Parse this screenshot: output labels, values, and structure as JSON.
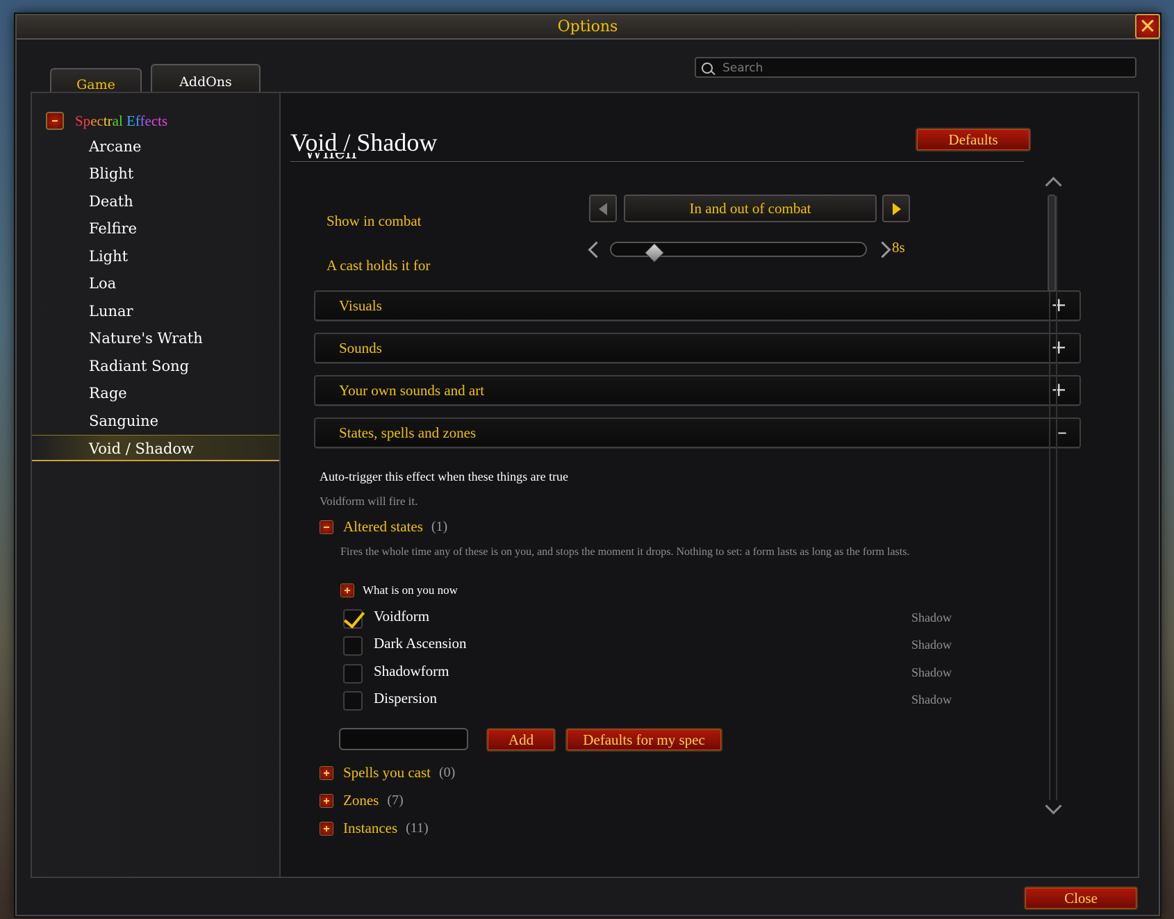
{
  "window": {
    "title": "Options",
    "close_icon": "close-x-icon"
  },
  "tabs": [
    {
      "label": "Game"
    },
    {
      "label": "AddOns"
    }
  ],
  "search": {
    "placeholder": "Search",
    "value": ""
  },
  "sidebar": {
    "category": {
      "label_parts": [
        "Sp",
        "ec",
        "tr",
        "al",
        " ",
        "Ef",
        "fe",
        "cts"
      ],
      "colors": [
        "#ff3b3b",
        "#ff8a2a",
        "#ffd11a",
        "#5ad13a",
        "#ffffff",
        "#35a8ff",
        "#9b5cff",
        "#e04ad8"
      ]
    },
    "items": [
      {
        "label": "Arcane"
      },
      {
        "label": "Blight"
      },
      {
        "label": "Death"
      },
      {
        "label": "Felfire"
      },
      {
        "label": "Light"
      },
      {
        "label": "Loa"
      },
      {
        "label": "Lunar"
      },
      {
        "label": "Nature's Wrath"
      },
      {
        "label": "Radiant Song"
      },
      {
        "label": "Rage"
      },
      {
        "label": "Sanguine"
      },
      {
        "label": "Void / Shadow",
        "selected": true
      }
    ]
  },
  "main": {
    "title": "Void / Shadow",
    "defaults_label": "Defaults",
    "cut_off_heading": "When",
    "show_in_combat": {
      "label": "Show in combat",
      "value": "In and out of combat"
    },
    "cast_hold": {
      "label": "A cast holds it for",
      "value": "8s",
      "level_fraction": 0.14
    },
    "sections": [
      {
        "label": "Visuals",
        "sign": "+"
      },
      {
        "label": "Sounds",
        "sign": "+"
      },
      {
        "label": "Your own sounds and art",
        "sign": "+"
      },
      {
        "label": "States, spells and zones",
        "sign": "–"
      }
    ],
    "auto_trigger": "Auto-trigger this effect when these things are true",
    "voidform_note": "Voidform will fire it.",
    "altered_states": {
      "label": "Altered states",
      "count": "(1)",
      "description": "Fires the whole time any of these is on you, and stops the moment it drops. Nothing to set: a form lasts as long as the form lasts.",
      "sub_label": "What is on you now",
      "entries": [
        {
          "label": "Voidform",
          "school": "Shadow",
          "checked": true
        },
        {
          "label": "Dark Ascension",
          "school": "Shadow",
          "checked": false
        },
        {
          "label": "Shadowform",
          "school": "Shadow",
          "checked": false
        },
        {
          "label": "Dispersion",
          "school": "Shadow",
          "checked": false
        }
      ],
      "add_label": "Add",
      "spec_defaults_label": "Defaults for my spec"
    },
    "groups": [
      {
        "label": "Spells you cast",
        "count": "(0)"
      },
      {
        "label": "Zones",
        "count": "(7)"
      },
      {
        "label": "Instances",
        "count": "(11)"
      }
    ]
  },
  "footer": {
    "close_label": "Close"
  }
}
